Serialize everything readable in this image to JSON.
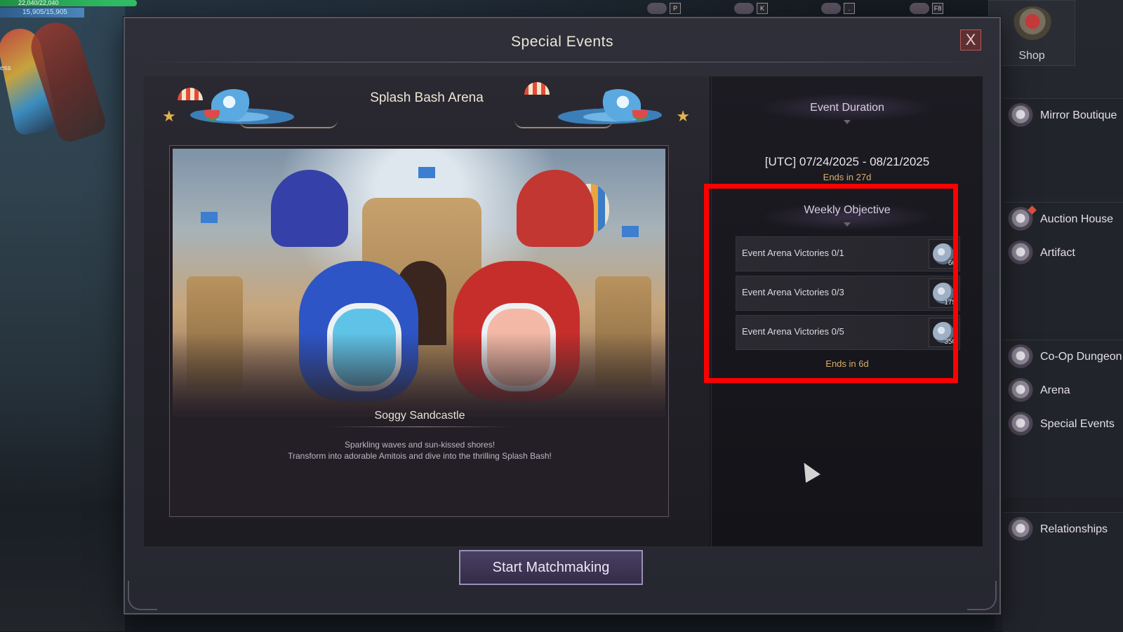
{
  "hud": {
    "hp_text": "22,040/22,040",
    "mp_text": "15,905/15,905",
    "left_partial_text": "ess"
  },
  "hotkeys": [
    {
      "key": "P",
      "icon": "character-icon"
    },
    {
      "key": "K",
      "icon": "skill-icon"
    },
    {
      "key": ".",
      "icon": "mount-icon"
    },
    {
      "key": "F8",
      "icon": "feather-icon"
    }
  ],
  "right_menu": {
    "shop_label": "Shop",
    "items": [
      {
        "label": "Mirror Boutique",
        "icon": "mirror-icon"
      },
      {
        "label": "Auction House",
        "icon": "scales-icon"
      },
      {
        "label": "Artifact",
        "icon": "artifact-icon"
      },
      {
        "label": "Co-Op Dungeon",
        "icon": "dungeon-gate-icon"
      },
      {
        "label": "Arena",
        "icon": "crossed-swords-icon"
      },
      {
        "label": "Special Events",
        "icon": "tent-icon"
      },
      {
        "label": "Relationships",
        "icon": "handshake-icon"
      }
    ]
  },
  "modal": {
    "title": "Special Events",
    "close_label": "X",
    "arena": {
      "title": "Splash Bash Arena",
      "map_name": "Soggy Sandcastle",
      "description_line1": "Sparkling waves and sun-kissed shores!",
      "description_line2": "Transform into adorable Amitois and dive into the thrilling Splash Bash!"
    },
    "duration": {
      "title": "Event Duration",
      "range": "[UTC] 07/24/2025 - 08/21/2025",
      "ends_in": "Ends in   27d"
    },
    "weekly": {
      "title": "Weekly Objective",
      "objectives": [
        {
          "label": "Event Arena Victories 0/1",
          "reward_qty": "60",
          "reward_icon": "moon-coin-icon"
        },
        {
          "label": "Event Arena Victories 0/3",
          "reward_qty": "175",
          "reward_icon": "moon-coin-icon"
        },
        {
          "label": "Event Arena Victories 0/5",
          "reward_qty": "350",
          "reward_icon": "moon-coin-icon"
        }
      ],
      "ends_in": "Ends in 6d"
    },
    "start_button": "Start Matchmaking"
  },
  "colors": {
    "highlight": "#ff0000",
    "accent_gold": "#d8b06a",
    "button_border": "#9a8fb8"
  }
}
